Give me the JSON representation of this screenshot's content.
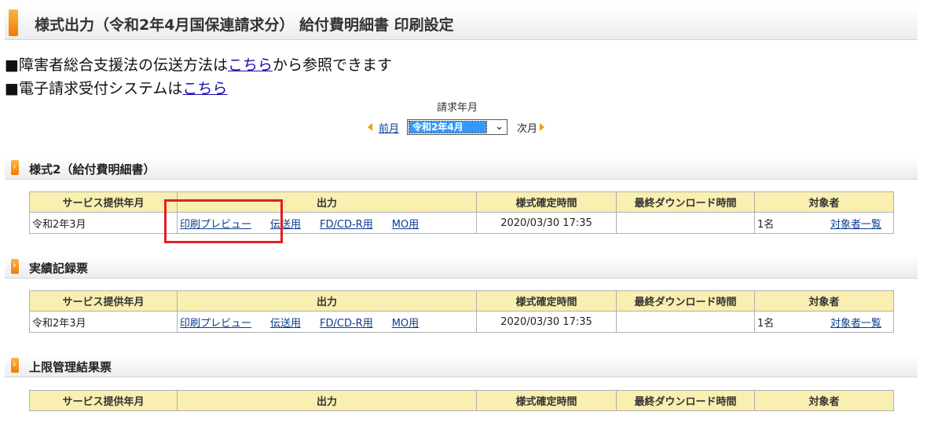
{
  "header": {
    "title": "様式出力（令和2年4月国保連請求分）  給付費明細書  印刷設定"
  },
  "notices": [
    {
      "prefix": "■障害者総合支援法の伝送方法は",
      "link": "こちら",
      "suffix": "から参照できます"
    },
    {
      "prefix": "■電子請求受付システムは",
      "link": "こちら",
      "suffix": ""
    }
  ],
  "month_picker": {
    "label": "請求年月",
    "prev_label": "前月",
    "selected": "令和2年4月",
    "next_label": "次月"
  },
  "table_headers": [
    "サービス提供年月",
    "出力",
    "様式確定時間",
    "最終ダウンロード時間",
    "対象者"
  ],
  "sections": [
    {
      "title": "様式2（給付費明細書）",
      "rows": [
        {
          "service_month": "令和2年3月",
          "outputs": [
            "印刷プレビュー",
            "伝送用",
            "FD/CD-R用",
            "MO用"
          ],
          "confirmed_time": "2020/03/30 17:35",
          "last_download": "",
          "count": "1名",
          "list_link": "対象者一覧"
        }
      ]
    },
    {
      "title": "実績記録票",
      "rows": [
        {
          "service_month": "令和2年3月",
          "outputs": [
            "印刷プレビュー",
            "伝送用",
            "FD/CD-R用",
            "MO用"
          ],
          "confirmed_time": "2020/03/30 17:35",
          "last_download": "",
          "count": "1名",
          "list_link": "対象者一覧"
        }
      ]
    },
    {
      "title": "上限管理結果票",
      "rows": []
    }
  ],
  "colors": {
    "accent": "#ef7d00",
    "table_header_bg": "#f8efb0",
    "highlight": "#e02020",
    "link": "#0b3d91"
  }
}
